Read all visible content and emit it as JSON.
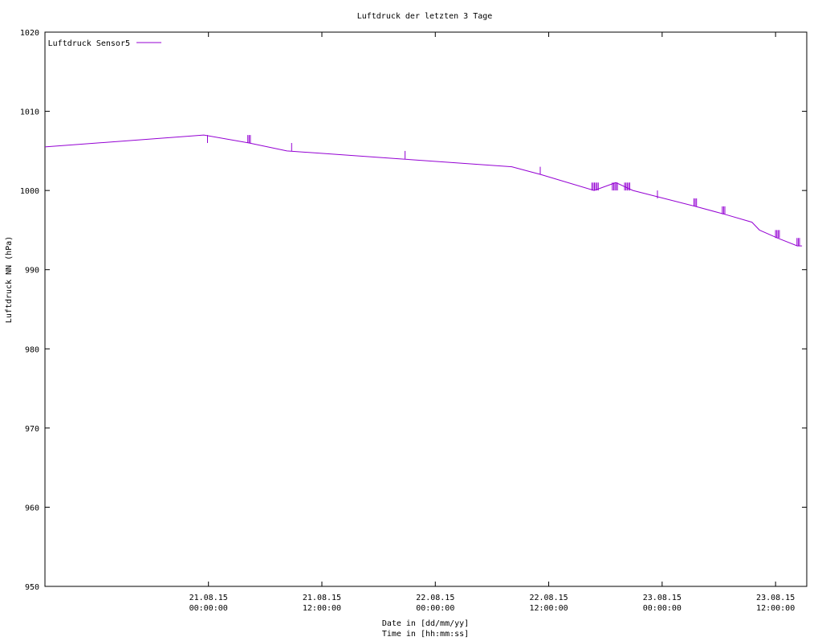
{
  "chart_data": {
    "type": "line",
    "title": "Luftdruck der letzten 3 Tage",
    "ylabel": "Luftdruck NN (hPa)",
    "xlabel_line1": "Date in [dd/mm/yy]",
    "xlabel_line2": "Time in [hh:mm:ss]",
    "ylim": [
      950,
      1020
    ],
    "yticks": [
      950,
      960,
      970,
      980,
      990,
      1000,
      1010,
      1020
    ],
    "xlim_hours": [
      -17.3,
      63.3
    ],
    "xticks": [
      {
        "t": 0,
        "date": "21.08.15",
        "time": "00:00:00"
      },
      {
        "t": 12,
        "date": "21.08.15",
        "time": "12:00:00"
      },
      {
        "t": 24,
        "date": "22.08.15",
        "time": "00:00:00"
      },
      {
        "t": 36,
        "date": "22.08.15",
        "time": "12:00:00"
      },
      {
        "t": 48,
        "date": "23.08.15",
        "time": "00:00:00"
      },
      {
        "t": 60,
        "date": "23.08.15",
        "time": "12:00:00"
      }
    ],
    "grid": false,
    "legend_position": "top-left",
    "series": [
      {
        "name": "Luftdruck Sensor5",
        "color": "#9400d3",
        "points": [
          [
            -17.3,
            1005.5
          ],
          [
            -0.5,
            1007.0
          ],
          [
            4.3,
            1006.0
          ],
          [
            8.3,
            1005.0
          ],
          [
            20.2,
            1004.0
          ],
          [
            32.1,
            1003.0
          ],
          [
            35.2,
            1002.0
          ],
          [
            40.8,
            1000.0
          ],
          [
            43.1,
            1001.0
          ],
          [
            44.9,
            1000.0
          ],
          [
            51.5,
            998.0
          ],
          [
            54.6,
            997.0
          ],
          [
            57.5,
            996.0
          ],
          [
            58.3,
            995.0
          ],
          [
            60.2,
            994.0
          ],
          [
            62.3,
            993.0
          ],
          [
            62.8,
            993.0
          ]
        ],
        "spikes": [
          {
            "t": -0.1,
            "low": 1006.0,
            "high": 1007.0,
            "count": 1
          },
          {
            "t": 4.3,
            "low": 1006.0,
            "high": 1007.0,
            "count": 3
          },
          {
            "t": 8.8,
            "low": 1005.0,
            "high": 1006.0,
            "count": 1
          },
          {
            "t": 20.8,
            "low": 1004.0,
            "high": 1005.0,
            "count": 1
          },
          {
            "t": 35.1,
            "low": 1002.0,
            "high": 1003.0,
            "count": 1
          },
          {
            "t": 40.9,
            "low": 1000.0,
            "high": 1001.0,
            "count": 6
          },
          {
            "t": 43.0,
            "low": 1000.0,
            "high": 1001.0,
            "count": 5
          },
          {
            "t": 44.3,
            "low": 1000.0,
            "high": 1001.0,
            "count": 5
          },
          {
            "t": 47.5,
            "low": 999.0,
            "high": 1000.0,
            "count": 1
          },
          {
            "t": 51.5,
            "low": 998.0,
            "high": 999.0,
            "count": 3
          },
          {
            "t": 54.5,
            "low": 997.0,
            "high": 998.0,
            "count": 3
          },
          {
            "t": 60.2,
            "low": 994.0,
            "high": 995.0,
            "count": 4
          },
          {
            "t": 62.4,
            "low": 993.0,
            "high": 994.0,
            "count": 3
          }
        ]
      }
    ]
  }
}
